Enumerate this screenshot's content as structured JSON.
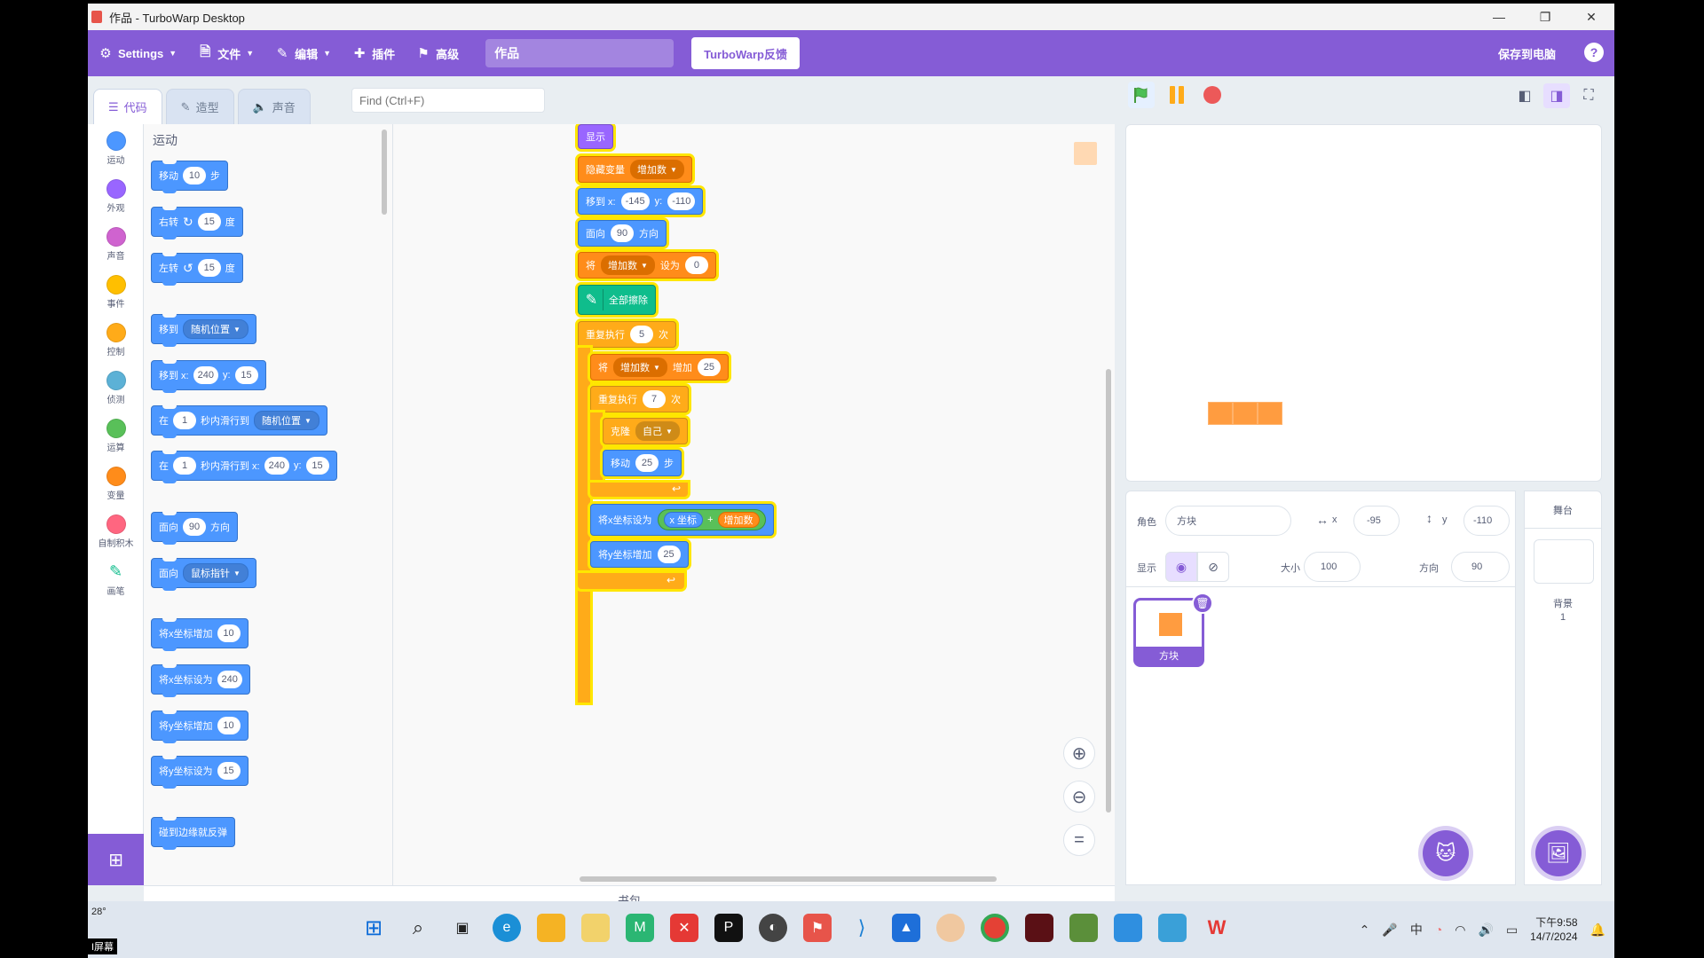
{
  "window": {
    "title": "作品 - TurboWarp Desktop",
    "min": "—",
    "max": "❐",
    "close": "✕"
  },
  "menubar": {
    "settings": "Settings",
    "file": "文件",
    "edit": "编辑",
    "addons": "插件",
    "advanced": "高级",
    "project_title": "作品",
    "feedback": "TurboWarp反馈",
    "save": "保存到电脑",
    "help": "?"
  },
  "tabs": {
    "code": "代码",
    "costumes": "造型",
    "sounds": "声音"
  },
  "find": {
    "placeholder": "Find (Ctrl+F)"
  },
  "categories": [
    {
      "label": "运动",
      "color": "#4c97ff"
    },
    {
      "label": "外观",
      "color": "#9966ff"
    },
    {
      "label": "声音",
      "color": "#cf63cf"
    },
    {
      "label": "事件",
      "color": "#ffbf00"
    },
    {
      "label": "控制",
      "color": "#ffab19"
    },
    {
      "label": "侦测",
      "color": "#5cb1d6"
    },
    {
      "label": "运算",
      "color": "#59c059"
    },
    {
      "label": "变量",
      "color": "#ff8c1a"
    },
    {
      "label": "自制积木",
      "color": "#ff6680"
    },
    {
      "label": "画笔",
      "color": "#0fbd8c"
    }
  ],
  "palette": {
    "heading": "运动",
    "move": {
      "pre": "移动",
      "val": "10",
      "post": "步"
    },
    "turn_right": {
      "pre": "右转",
      "val": "15",
      "post": "度"
    },
    "turn_left": {
      "pre": "左转",
      "val": "15",
      "post": "度"
    },
    "goto": {
      "pre": "移到",
      "opt": "随机位置"
    },
    "goto_xy": {
      "pre": "移到 x:",
      "x": "240",
      "ylabel": "y:",
      "y": "15"
    },
    "glide": {
      "pre": "在",
      "val": "1",
      "mid": "秒内滑行到",
      "opt": "随机位置"
    },
    "glide_xy": {
      "pre": "在",
      "val": "1",
      "mid": "秒内滑行到 x:",
      "x": "240",
      "ylabel": "y:",
      "y": "15"
    },
    "point_dir": {
      "pre": "面向",
      "val": "90",
      "post": "方向"
    },
    "point_to": {
      "pre": "面向",
      "opt": "鼠标指针"
    },
    "change_x": {
      "pre": "将x坐标增加",
      "val": "10"
    },
    "set_x": {
      "pre": "将x坐标设为",
      "val": "240"
    },
    "change_y": {
      "pre": "将y坐标增加",
      "val": "10"
    },
    "set_y": {
      "pre": "将y坐标设为",
      "val": "15"
    },
    "bounce": {
      "pre": "碰到边缘就反弹"
    }
  },
  "script": {
    "show": "显示",
    "hide_var": {
      "pre": "隐藏变量",
      "opt": "增加数"
    },
    "goto_xy": {
      "pre": "移到 x:",
      "x": "-145",
      "ylabel": "y:",
      "y": "-110"
    },
    "point_dir": {
      "pre": "面向",
      "val": "90",
      "post": "方向"
    },
    "set_var": {
      "pre": "将",
      "opt": "增加数",
      "mid": "设为",
      "val": "0"
    },
    "pen_clear": "全部擦除",
    "repeat_outer": {
      "pre": "重复执行",
      "val": "5",
      "post": "次"
    },
    "change_var": {
      "pre": "将",
      "opt": "增加数",
      "mid": "增加",
      "val": "25"
    },
    "repeat_inner": {
      "pre": "重复执行",
      "val": "7",
      "post": "次"
    },
    "clone": {
      "pre": "克隆",
      "opt": "自己"
    },
    "move": {
      "pre": "移动",
      "val": "25",
      "post": "步"
    },
    "set_x": {
      "pre": "将x坐标设为",
      "rep1": "x 坐标",
      "op": "+",
      "rep2": "增加数"
    },
    "change_y": {
      "pre": "将y坐标增加",
      "val": "25"
    }
  },
  "backpack": "书包",
  "sprite_info": {
    "sprite_label": "角色",
    "sprite_name": "方块",
    "x_label": "x",
    "x": "-95",
    "y_label": "y",
    "y": "-110",
    "show_label": "显示",
    "size_label": "大小",
    "size": "100",
    "direction_label": "方向",
    "direction": "90"
  },
  "sprite_tile": {
    "name": "方块"
  },
  "stage_pane": {
    "header": "舞台",
    "backdrops_label": "背景",
    "backdrops_count": "1"
  },
  "taskbar": {
    "weather": "28°",
    "screen_label": "I屏幕",
    "time": "下午9:58",
    "date": "14/7/2024",
    "lang": "中"
  },
  "colors": {
    "accent": "#855cd6",
    "motion": "#4c97ff",
    "control": "#ffab19",
    "variable": "#ff8c1a",
    "pen": "#0fbd8c"
  }
}
